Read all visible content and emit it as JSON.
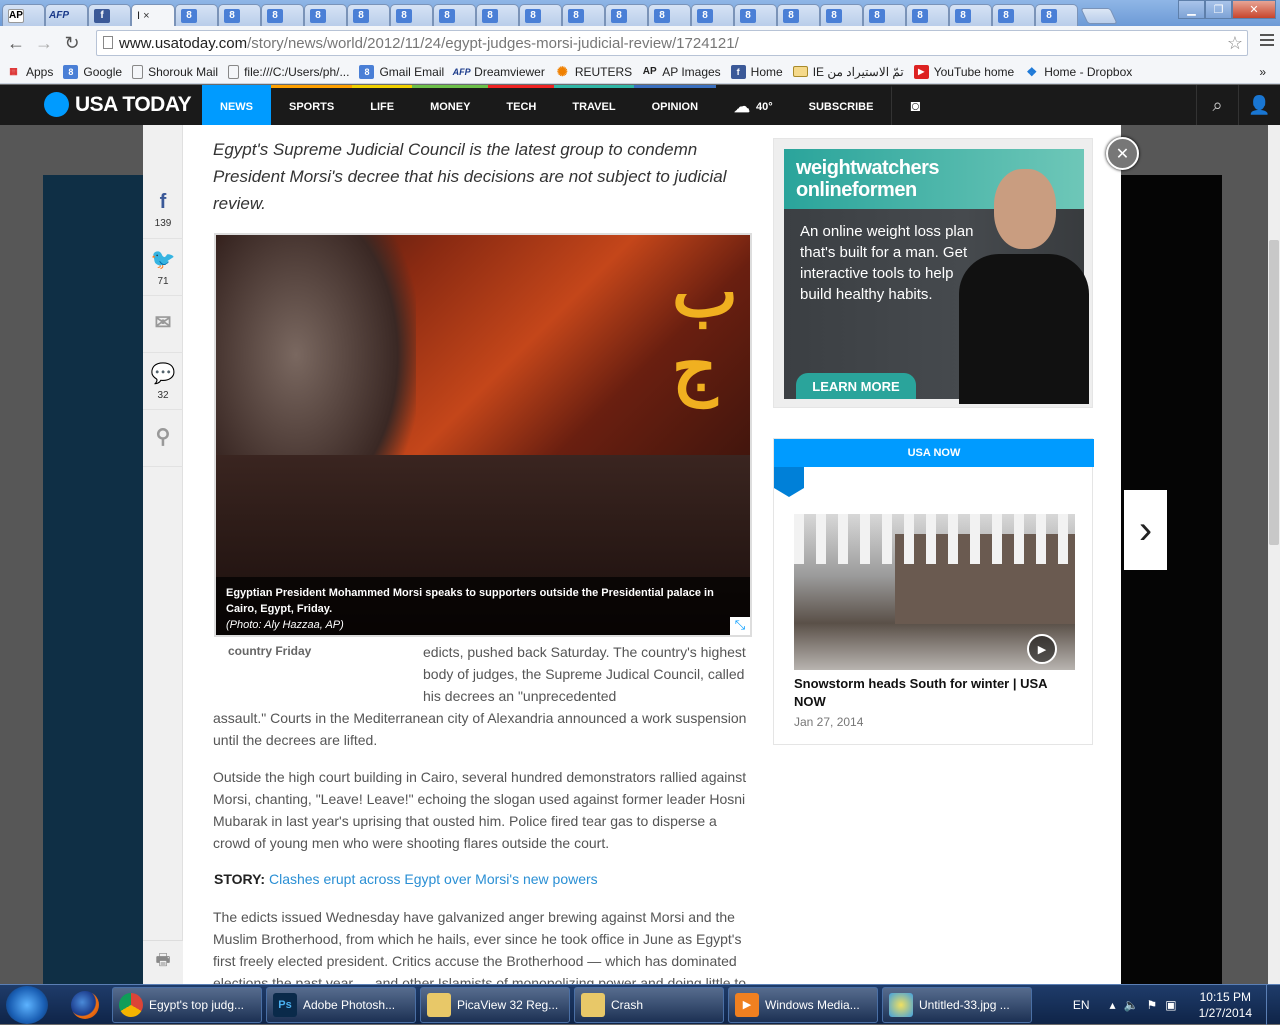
{
  "browser": {
    "tabs": [
      "AP",
      "AFP",
      "f",
      "",
      "",
      "",
      "",
      "",
      "",
      "",
      "",
      "",
      "",
      "",
      "",
      "",
      "",
      "",
      "",
      "",
      "",
      "",
      "",
      "",
      "",
      "",
      ""
    ],
    "active_tab_close": "×",
    "url_host": "www.usatoday.com",
    "url_path": "/story/news/world/2012/11/24/egypt-judges-morsi-judicial-review/1724121/",
    "bookmarks": [
      "Apps",
      "Google",
      "Shorouk Mail",
      "file:///C:/Users/ph/...",
      "Gmail Email",
      "Dreamviewer",
      "REUTERS",
      "AP Images",
      "Home",
      "IE تمّ الاستيراد من",
      "YouTube home",
      "Home - Dropbox"
    ],
    "bookmarks_more": "»"
  },
  "site": {
    "logo": "USA TODAY",
    "nav": [
      "NEWS",
      "SPORTS",
      "LIFE",
      "MONEY",
      "TECH",
      "TRAVEL",
      "OPINION"
    ],
    "weather_temp": "40°",
    "subscribe": "SUBSCRIBE"
  },
  "share": {
    "facebook_count": "139",
    "twitter_count": "71",
    "comments_count": "32"
  },
  "article": {
    "lede": "Egypt's Supreme Judicial Council is the latest group to condemn President Morsi's decree that his decisions are not subject to judicial review.",
    "photo_caption": "Egyptian President Mohammed Morsi speaks to supporters outside the Presidential palace in Cairo, Egypt, Friday.",
    "photo_credit": "(Photo: Aly Hazzaa, AP)",
    "ghost_caption": "country Friday",
    "p1a": "edicts, pushed back Saturday. The country's highest body of judges, the Supreme Judical Council, called his decrees an \"unprecedented",
    "p1b": "assault.\" Courts in the Mediterranean city of Alexandria announced a work suspension until the decrees are lifted.",
    "p2": "Outside the high court building in Cairo, several hundred demonstrators rallied against Morsi, chanting, \"Leave! Leave!\" echoing the slogan used against former leader Hosni Mubarak in last year's uprising that ousted him. Police fired tear gas to disperse a crowd of young men who were shooting flares outside the court.",
    "story_label": "STORY:",
    "story_link": "Clashes erupt across Egypt over Morsi's new powers",
    "p3": "The edicts issued Wednesday have galvanized anger brewing against Morsi and the Muslim Brotherhood, from which he hails, ever since he took office in June as Egypt's first freely elected president. Critics accuse the Brotherhood — which has dominated elections the past year — and other Islamists of monopolizing power and doing little to"
  },
  "ad": {
    "brand_line1": "weightwatchers",
    "brand_line2": "onlineformen",
    "body": "An online weight loss plan that's built for a man. Get interactive tools to help build healthy habits.",
    "cta": "LEARN MORE"
  },
  "usa_now": {
    "header": "USA NOW",
    "title": "Snowstorm heads South for winter | USA NOW",
    "date": "Jan 27, 2014"
  },
  "taskbar": {
    "items": [
      "Egypt's top judg...",
      "Adobe Photosh...",
      "PicaView 32 Reg...",
      "Crash",
      "Windows Media...",
      "Untitled-33.jpg ..."
    ],
    "lang": "EN",
    "time": "10:15 PM",
    "date": "1/27/2014"
  },
  "colors": {
    "usat_blue": "#009bff",
    "ad_teal": "#2aa49b",
    "link": "#2a8fd4"
  }
}
